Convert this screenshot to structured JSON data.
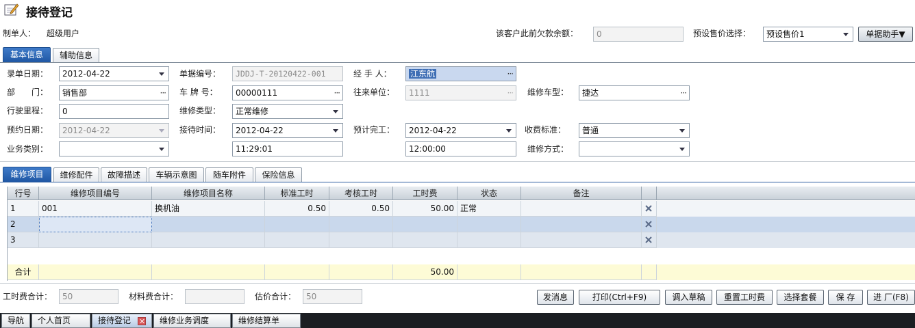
{
  "page": {
    "title": "接待登记",
    "icon": "edit-document-icon"
  },
  "header": {
    "creator_label": "制单人：",
    "creator_value": "超级用户",
    "arrears_label": "该客户此前欠款余额：",
    "arrears_value": "0",
    "preset_label": "预设售价选择：",
    "preset_value": "预设售价1",
    "helper_button": "单据助手▼"
  },
  "main_tabs": [
    "基本信息",
    "辅助信息"
  ],
  "form": {
    "record_date_label": "录单日期：",
    "record_date": "2012-04-22",
    "doc_no_label": "单据编号：",
    "doc_no": "JDDJ-T-20120422-001",
    "handler_label": "经 手 人：",
    "handler": "江东航",
    "dept_label": "部　　门：",
    "dept": "销售部",
    "plate_label": "车 牌 号：",
    "plate": "00000111",
    "partner_label": "往来单位：",
    "partner": "1111",
    "model_label": "维修车型：",
    "model": "捷达",
    "mileage_label": "行驶里程：",
    "mileage": "0",
    "repair_type_label": "维修类型：",
    "repair_type": "正常维修",
    "appt_date_label": "预约日期：",
    "appt_date": "2012-04-22",
    "reception_time_label": "接待时间：",
    "reception_date": "2012-04-22",
    "reception_time": "11:29:01",
    "est_finish_label": "预计完工：",
    "est_finish_date": "2012-04-22",
    "est_finish_time": "12:00:00",
    "fee_std_label": "收费标准：",
    "fee_std": "普通",
    "biz_type_label": "业务类别：",
    "biz_type": "",
    "repair_method_label": "维修方式：",
    "repair_method": ""
  },
  "sub_tabs": [
    "维修项目",
    "维修配件",
    "故障描述",
    "车辆示意图",
    "随车附件",
    "保险信息"
  ],
  "grid": {
    "columns": [
      "行号",
      "维修项目编号",
      "维修项目名称",
      "标准工时",
      "考核工时",
      "工时费",
      "状态",
      "备注"
    ],
    "rows": [
      [
        "1",
        "001",
        "换机油",
        "0.50",
        "0.50",
        "50.00",
        "正常",
        ""
      ],
      [
        "2",
        "",
        "",
        "",
        "",
        "",
        "",
        ""
      ],
      [
        "3",
        "",
        "",
        "",
        "",
        "",
        "",
        ""
      ]
    ],
    "total_label": "合计",
    "total_fee": "50.00"
  },
  "footer": {
    "labor_total_label": "工时费合计：",
    "labor_total": "50",
    "material_total_label": "材料费合计：",
    "material_total": "",
    "estimate_label": "估价合计：",
    "estimate": "50",
    "buttons": [
      "发消息",
      "打印(Ctrl+F9)",
      "调入草稿",
      "重置工时费",
      "选择套餐",
      "保 存",
      "进 厂(F8)"
    ]
  },
  "taskbar": [
    "导航",
    "个人首页",
    "接待登记",
    "维修业务调度",
    "维修结算单"
  ],
  "colors": {
    "accent": "#2a62b0",
    "selection": "#c9d8ef",
    "total_row": "#fdfbd6"
  }
}
